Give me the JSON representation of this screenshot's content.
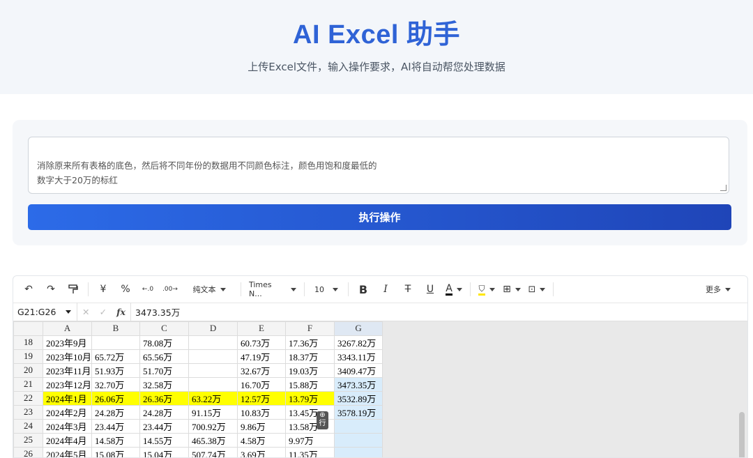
{
  "hero": {
    "title": "AI Excel 助手",
    "subtitle": "上传Excel文件，输入操作要求，AI将自动帮您处理数据"
  },
  "prompt": {
    "value": "消除原来所有表格的底色，然后将不同年份的数据用不同颜色标注，颜色用饱和度最低的\n数字大于20万的标红"
  },
  "execute_button": "执行操作",
  "toolbar": {
    "items": [
      {
        "name": "undo-icon",
        "glyph": "↶"
      },
      {
        "name": "redo-icon",
        "glyph": "↷"
      },
      {
        "name": "format-painter-icon",
        "glyph": "🖌"
      },
      {
        "name": "currency-icon",
        "glyph": "¥"
      },
      {
        "name": "percent-icon",
        "glyph": "%"
      },
      {
        "name": "increase-decimal-icon",
        "glyph": ".0"
      },
      {
        "name": "decrease-decimal-icon",
        "glyph": ".00"
      }
    ],
    "number_format": "纯文本",
    "font_family": "Times N...",
    "font_size": "10",
    "bold": "B",
    "italic": "I",
    "strike": "T",
    "underline": "U",
    "font_color": "A",
    "more": "更多"
  },
  "formula_bar": {
    "cell_ref": "G21:G26",
    "fx": "fx",
    "value": "3473.35万"
  },
  "grid": {
    "columns": [
      "A",
      "B",
      "C",
      "D",
      "E",
      "F",
      "G"
    ],
    "rows": [
      {
        "n": "18",
        "cells": [
          "2023年9月",
          "",
          "78.08万",
          "",
          "60.73万",
          "17.36万",
          "3267.82万"
        ]
      },
      {
        "n": "19",
        "cells": [
          "2023年10月",
          "65.72万",
          "65.56万",
          "",
          "47.19万",
          "18.37万",
          "3343.11万"
        ]
      },
      {
        "n": "20",
        "cells": [
          "2023年11月",
          "51.93万",
          "51.70万",
          "",
          "32.67万",
          "19.03万",
          "3409.47万"
        ]
      },
      {
        "n": "21",
        "cells": [
          "2023年12月",
          "32.70万",
          "32.58万",
          "",
          "16.70万",
          "15.88万",
          "3473.35万"
        ]
      },
      {
        "n": "22",
        "cells": [
          "2024年1月",
          "26.06万",
          "26.36万",
          "63.22万",
          "12.57万",
          "13.79万",
          "3532.89万"
        ]
      },
      {
        "n": "23",
        "cells": [
          "2024年2月",
          "24.28万",
          "24.28万",
          "91.15万",
          "10.83万",
          "13.45万",
          "3578.19万"
        ]
      },
      {
        "n": "24",
        "cells": [
          "2024年3月",
          "23.44万",
          "23.44万",
          "700.92万",
          "9.86万",
          "13.58万",
          ""
        ]
      },
      {
        "n": "25",
        "cells": [
          "2024年4月",
          "14.58万",
          "14.55万",
          "465.38万",
          "4.58万",
          "9.97万",
          ""
        ]
      },
      {
        "n": "26",
        "cells": [
          "2024年5月",
          "15.08万",
          "15.04万",
          "507.74万",
          "3.69万",
          "11.35万",
          ""
        ]
      }
    ],
    "highlight_row": "22",
    "insert_badge": "行"
  },
  "colors": {
    "accent": "#2f63d6",
    "highlight": "#ffff00",
    "selection": "#d8ecfb"
  }
}
